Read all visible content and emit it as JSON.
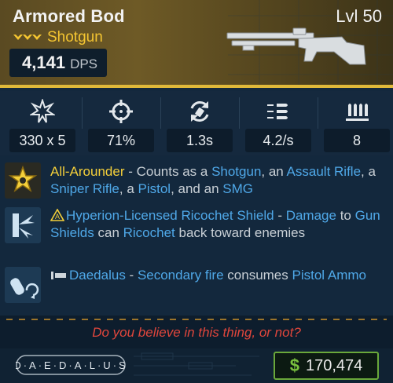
{
  "header": {
    "name": "Armored Bod",
    "level": "Lvl 50",
    "type": "Shotgun",
    "dps_value": "4,141",
    "dps_label": "DPS",
    "rarity_color": "#f4c531",
    "rarity_icon": "chevrons-icon"
  },
  "stats": [
    {
      "icon": "damage-burst-icon",
      "value": "330 x 5"
    },
    {
      "icon": "crosshair-icon",
      "value": "71%"
    },
    {
      "icon": "reload-icon",
      "value": "1.3s"
    },
    {
      "icon": "fire-rate-icon",
      "value": "4.2/s"
    },
    {
      "icon": "ammo-icon",
      "value": "8"
    }
  ],
  "perks": [
    {
      "icon": "star-shield-icon",
      "title": "All-Arounder",
      "t1": " - Counts as a ",
      "k1": "Shotgun",
      "t2": ", an ",
      "k2": "Assault Rifle",
      "t3": ", a ",
      "k3": "Sniper Rifle",
      "t4": ", a ",
      "k4": "Pistol",
      "t5": ", and an ",
      "k5": "SMG"
    },
    {
      "icon": "ricochet-shield-icon",
      "prefix_icon": "warning-triangle-icon",
      "title": "Hyperion-Licensed Ricochet Shield",
      "t1": " - ",
      "k1": "Damage",
      "t2": " to ",
      "k2": "Gun Shields",
      "t3": " can ",
      "k3": "Ricochet",
      "t4": " back toward enemies"
    },
    {
      "icon": "grenade-reload-icon",
      "prefix_icon": "part-icon",
      "title": "Daedalus",
      "t1": " - ",
      "k1": "Secondary fire",
      "t2": " consumes ",
      "k2": "Pistol Ammo"
    }
  ],
  "flavor": "Do you believe in this thing, or not?",
  "footer": {
    "manufacturer": "DAEDALUS",
    "currency_symbol": "$",
    "price": "170,474"
  },
  "colors": {
    "accent_gold": "#e0b93a",
    "keyword_blue": "#4fa8e8",
    "flavor_red": "#e0463c",
    "price_green": "#79c23e"
  }
}
